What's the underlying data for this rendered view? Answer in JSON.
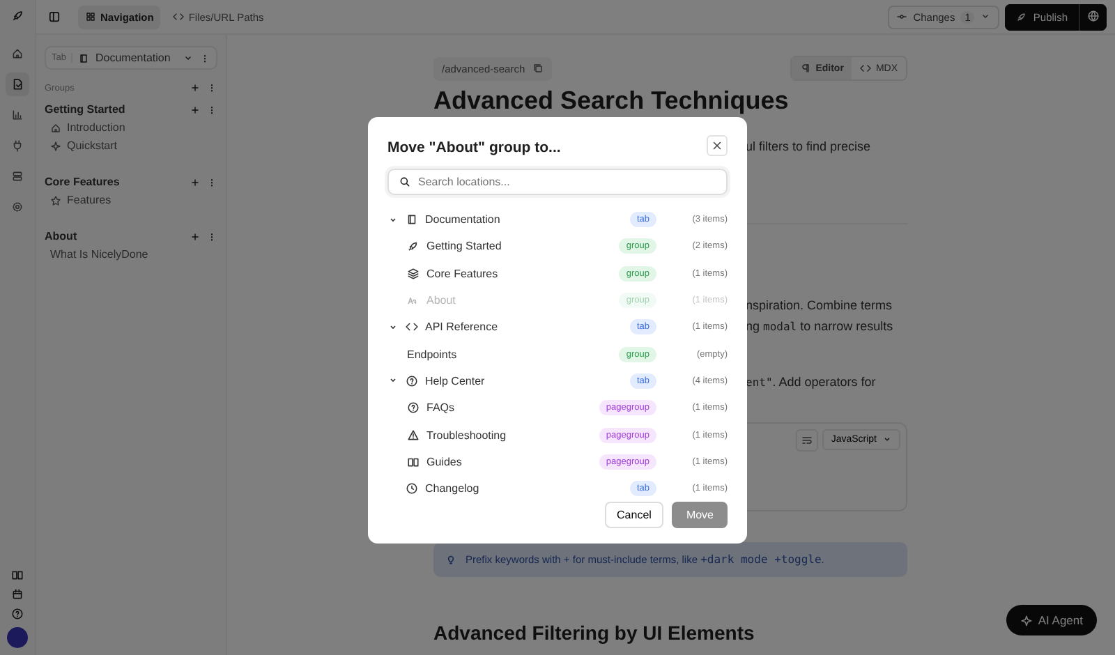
{
  "topbar": {
    "tabs": [
      {
        "label": "Navigation",
        "selected": true
      },
      {
        "label": "Files/URL Paths",
        "selected": false
      }
    ],
    "changes": {
      "label": "Changes",
      "count": "1"
    },
    "publish": "Publish"
  },
  "rail": {
    "items": [
      {
        "selected": false
      },
      {
        "selected": true
      },
      {
        "selected": false
      },
      {
        "selected": false
      },
      {
        "selected": false
      },
      {
        "selected": false
      }
    ]
  },
  "sidebar": {
    "tab_label": "Tab",
    "tab_value": "Documentation",
    "groups_label": "Groups",
    "groups": [
      {
        "title": "Getting Started",
        "items": [
          "Introduction",
          "Quickstart"
        ]
      },
      {
        "title": "Core Features",
        "items": [
          "Features"
        ]
      },
      {
        "title": "About",
        "items": [
          "What Is NicelyDone"
        ]
      }
    ]
  },
  "page": {
    "path": "/advanced-search",
    "modes": [
      {
        "label": "Editor",
        "selected": true
      },
      {
        "label": "MDX",
        "selected": false
      }
    ],
    "title": "Advanced Search Techniques",
    "fragments": [
      [
        {
          "kind": "text",
          "text": "ul filters to find precise"
        }
      ],
      [
        {
          "kind": "text",
          "text": "nspiration. Combine terms"
        }
      ],
      [
        {
          "kind": "text",
          "text": "ng "
        },
        {
          "kind": "code",
          "text": "modal"
        },
        {
          "kind": "text",
          "text": " to narrow results"
        }
      ],
      [
        {
          "kind": "code",
          "text": "ent\""
        },
        {
          "kind": "text",
          "text": ". Add operators for"
        }
      ]
    ],
    "code_language": "JavaScript",
    "tip": [
      {
        "kind": "text",
        "text": "Prefix keywords with + for must-include terms, like "
      },
      {
        "kind": "code",
        "text": "+dark mode +toggle"
      },
      {
        "kind": "text",
        "text": "."
      }
    ],
    "heading_2": "Advanced Filtering by UI Elements"
  },
  "ai_agent": "AI Agent",
  "dialog": {
    "title": "Move \"About\" group to...",
    "search": {
      "placeholder": "Search locations..."
    },
    "tree": [
      {
        "label": "Documentation",
        "kind": "tab",
        "badge": "tab",
        "count": "(3 items)",
        "expanded": true,
        "disabled": false,
        "children": [
          {
            "label": "Getting Started",
            "kind": "group",
            "badge": "group",
            "count": "(2 items)",
            "disabled": false
          },
          {
            "label": "Core Features",
            "kind": "group",
            "badge": "group",
            "count": "(1 items)",
            "disabled": false
          },
          {
            "label": "About",
            "kind": "group",
            "badge": "group",
            "count": "(1 items)",
            "disabled": true
          }
        ]
      },
      {
        "label": "API Reference",
        "kind": "tab",
        "badge": "tab",
        "count": "(1 items)",
        "expanded": true,
        "disabled": false,
        "children": [
          {
            "label": "Endpoints",
            "kind": "group",
            "badge": "group",
            "count": "(empty)",
            "disabled": false
          }
        ]
      },
      {
        "label": "Help Center",
        "kind": "tab",
        "badge": "tab",
        "count": "(4 items)",
        "expanded": true,
        "disabled": false,
        "children": [
          {
            "label": "FAQs",
            "kind": "pagegroup",
            "badge": "pagegroup",
            "count": "(1 items)",
            "disabled": false
          },
          {
            "label": "Troubleshooting",
            "kind": "pagegroup",
            "badge": "pagegroup",
            "count": "(1 items)",
            "disabled": false
          },
          {
            "label": "Guides",
            "kind": "pagegroup",
            "badge": "pagegroup",
            "count": "(1 items)",
            "disabled": false
          }
        ]
      },
      {
        "label": "Changelog",
        "kind": "tab",
        "badge": "tab",
        "count": "(1 items)",
        "disabled": false
      }
    ],
    "buttons": {
      "cancel": "Cancel",
      "move": "Move",
      "move_disabled": true
    }
  }
}
